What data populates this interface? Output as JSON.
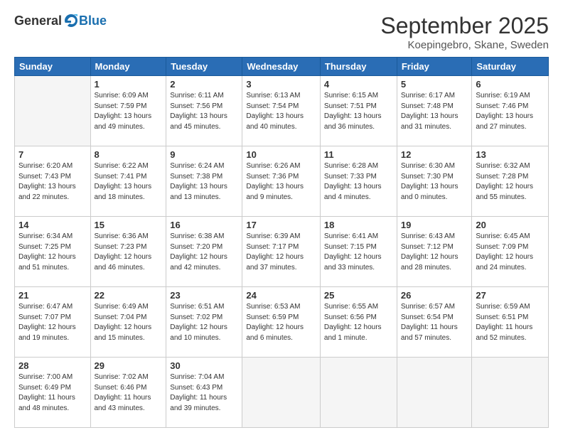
{
  "logo": {
    "general": "General",
    "blue": "Blue"
  },
  "title": "September 2025",
  "subtitle": "Koepingebro, Skane, Sweden",
  "days_header": [
    "Sunday",
    "Monday",
    "Tuesday",
    "Wednesday",
    "Thursday",
    "Friday",
    "Saturday"
  ],
  "weeks": [
    [
      {
        "day": "",
        "empty": true
      },
      {
        "day": "1",
        "sunrise": "6:09 AM",
        "sunset": "7:59 PM",
        "daylight": "13 hours and 49 minutes."
      },
      {
        "day": "2",
        "sunrise": "6:11 AM",
        "sunset": "7:56 PM",
        "daylight": "13 hours and 45 minutes."
      },
      {
        "day": "3",
        "sunrise": "6:13 AM",
        "sunset": "7:54 PM",
        "daylight": "13 hours and 40 minutes."
      },
      {
        "day": "4",
        "sunrise": "6:15 AM",
        "sunset": "7:51 PM",
        "daylight": "13 hours and 36 minutes."
      },
      {
        "day": "5",
        "sunrise": "6:17 AM",
        "sunset": "7:48 PM",
        "daylight": "13 hours and 31 minutes."
      },
      {
        "day": "6",
        "sunrise": "6:19 AM",
        "sunset": "7:46 PM",
        "daylight": "13 hours and 27 minutes."
      }
    ],
    [
      {
        "day": "7",
        "sunrise": "6:20 AM",
        "sunset": "7:43 PM",
        "daylight": "13 hours and 22 minutes."
      },
      {
        "day": "8",
        "sunrise": "6:22 AM",
        "sunset": "7:41 PM",
        "daylight": "13 hours and 18 minutes."
      },
      {
        "day": "9",
        "sunrise": "6:24 AM",
        "sunset": "7:38 PM",
        "daylight": "13 hours and 13 minutes."
      },
      {
        "day": "10",
        "sunrise": "6:26 AM",
        "sunset": "7:36 PM",
        "daylight": "13 hours and 9 minutes."
      },
      {
        "day": "11",
        "sunrise": "6:28 AM",
        "sunset": "7:33 PM",
        "daylight": "13 hours and 4 minutes."
      },
      {
        "day": "12",
        "sunrise": "6:30 AM",
        "sunset": "7:30 PM",
        "daylight": "13 hours and 0 minutes."
      },
      {
        "day": "13",
        "sunrise": "6:32 AM",
        "sunset": "7:28 PM",
        "daylight": "12 hours and 55 minutes."
      }
    ],
    [
      {
        "day": "14",
        "sunrise": "6:34 AM",
        "sunset": "7:25 PM",
        "daylight": "12 hours and 51 minutes."
      },
      {
        "day": "15",
        "sunrise": "6:36 AM",
        "sunset": "7:23 PM",
        "daylight": "12 hours and 46 minutes."
      },
      {
        "day": "16",
        "sunrise": "6:38 AM",
        "sunset": "7:20 PM",
        "daylight": "12 hours and 42 minutes."
      },
      {
        "day": "17",
        "sunrise": "6:39 AM",
        "sunset": "7:17 PM",
        "daylight": "12 hours and 37 minutes."
      },
      {
        "day": "18",
        "sunrise": "6:41 AM",
        "sunset": "7:15 PM",
        "daylight": "12 hours and 33 minutes."
      },
      {
        "day": "19",
        "sunrise": "6:43 AM",
        "sunset": "7:12 PM",
        "daylight": "12 hours and 28 minutes."
      },
      {
        "day": "20",
        "sunrise": "6:45 AM",
        "sunset": "7:09 PM",
        "daylight": "12 hours and 24 minutes."
      }
    ],
    [
      {
        "day": "21",
        "sunrise": "6:47 AM",
        "sunset": "7:07 PM",
        "daylight": "12 hours and 19 minutes."
      },
      {
        "day": "22",
        "sunrise": "6:49 AM",
        "sunset": "7:04 PM",
        "daylight": "12 hours and 15 minutes."
      },
      {
        "day": "23",
        "sunrise": "6:51 AM",
        "sunset": "7:02 PM",
        "daylight": "12 hours and 10 minutes."
      },
      {
        "day": "24",
        "sunrise": "6:53 AM",
        "sunset": "6:59 PM",
        "daylight": "12 hours and 6 minutes."
      },
      {
        "day": "25",
        "sunrise": "6:55 AM",
        "sunset": "6:56 PM",
        "daylight": "12 hours and 1 minute."
      },
      {
        "day": "26",
        "sunrise": "6:57 AM",
        "sunset": "6:54 PM",
        "daylight": "11 hours and 57 minutes."
      },
      {
        "day": "27",
        "sunrise": "6:59 AM",
        "sunset": "6:51 PM",
        "daylight": "11 hours and 52 minutes."
      }
    ],
    [
      {
        "day": "28",
        "sunrise": "7:00 AM",
        "sunset": "6:49 PM",
        "daylight": "11 hours and 48 minutes."
      },
      {
        "day": "29",
        "sunrise": "7:02 AM",
        "sunset": "6:46 PM",
        "daylight": "11 hours and 43 minutes."
      },
      {
        "day": "30",
        "sunrise": "7:04 AM",
        "sunset": "6:43 PM",
        "daylight": "11 hours and 39 minutes."
      },
      {
        "day": "",
        "empty": true
      },
      {
        "day": "",
        "empty": true
      },
      {
        "day": "",
        "empty": true
      },
      {
        "day": "",
        "empty": true
      }
    ]
  ],
  "labels": {
    "sunrise": "Sunrise:",
    "sunset": "Sunset:",
    "daylight": "Daylight:"
  }
}
